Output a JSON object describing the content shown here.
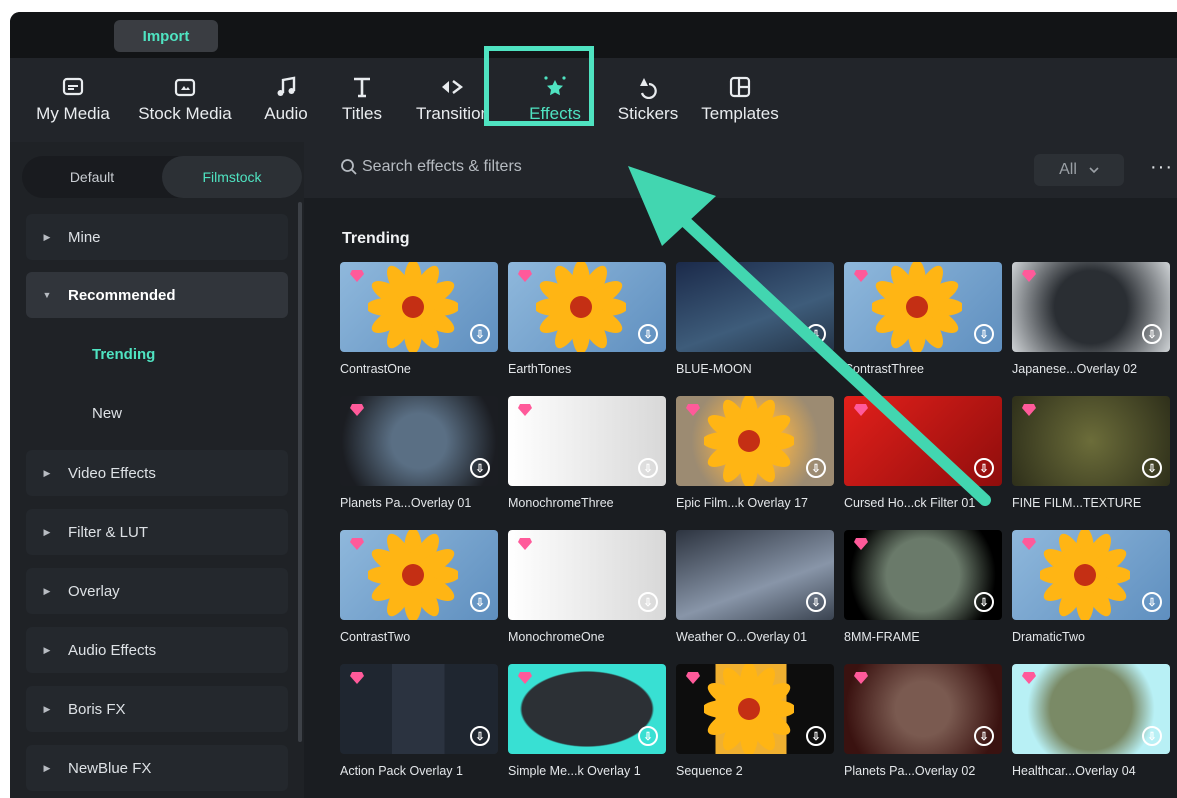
{
  "top": {
    "import_label": "Import"
  },
  "toolbar": {
    "items": [
      {
        "label": "My Media",
        "icon": "media-icon"
      },
      {
        "label": "Stock Media",
        "icon": "stock-icon"
      },
      {
        "label": "Audio",
        "icon": "music-icon"
      },
      {
        "label": "Titles",
        "icon": "titles-icon"
      },
      {
        "label": "Transition",
        "icon": "transition-icon"
      },
      {
        "label": "Effects",
        "icon": "effects-icon"
      },
      {
        "label": "Stickers",
        "icon": "stickers-icon"
      },
      {
        "label": "Templates",
        "icon": "templates-icon"
      }
    ],
    "active": "Effects"
  },
  "sidebar": {
    "tabs": [
      "Default",
      "Filmstock"
    ],
    "selected_tab": "Filmstock",
    "items": [
      {
        "label": "Mine"
      },
      {
        "label": "Recommended"
      },
      {
        "label": "Trending"
      },
      {
        "label": "New"
      },
      {
        "label": "Video Effects"
      },
      {
        "label": "Filter & LUT"
      },
      {
        "label": "Overlay"
      },
      {
        "label": "Audio Effects"
      },
      {
        "label": "Boris FX"
      },
      {
        "label": "NewBlue FX"
      }
    ]
  },
  "main": {
    "search_placeholder": "Search effects & filters",
    "filter_value": "All",
    "more": "···",
    "section": "Trending",
    "effects": [
      "ContrastOne",
      "EarthTones",
      "BLUE-MOON",
      "ContrastThree",
      "Japanese...Overlay 02",
      "Planets Pa...Overlay 01",
      "MonochromeThree",
      "Epic Film...k Overlay 17",
      "Cursed Ho...ck Filter 01",
      "FINE FILM...TEXTURE",
      "ContrastTwo",
      "MonochromeOne",
      "Weather O...Overlay 01",
      "8MM-FRAME",
      "DramaticTwo",
      "Action Pack Overlay 1",
      "Simple Me...k Overlay 1",
      "Sequence 2",
      "Planets Pa...Overlay 02",
      "Healthcar...Overlay 04"
    ]
  },
  "colors": {
    "accent": "#4fe3c1",
    "gem": "#ff5a9a",
    "background": "#15181c"
  }
}
